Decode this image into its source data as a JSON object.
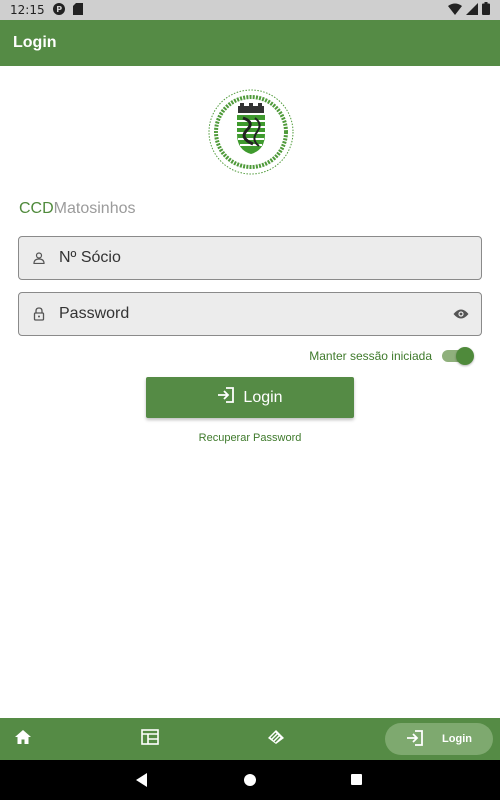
{
  "status_bar": {
    "time": "12:15"
  },
  "app_bar": {
    "title": "Login"
  },
  "brand": {
    "part1": "CCD",
    "part2": "Matosinhos"
  },
  "form": {
    "user": {
      "placeholder": "Nº Sócio",
      "value": ""
    },
    "password": {
      "placeholder": "Password",
      "value": ""
    },
    "remember_label": "Manter sessão iniciada",
    "remember_checked": true,
    "login_label": "Login",
    "recover_label": "Recuperar Password"
  },
  "bottom_nav": {
    "items": [
      {
        "icon": "home-icon"
      },
      {
        "icon": "calendar-icon"
      },
      {
        "icon": "cards-icon"
      },
      {
        "icon": "login-icon",
        "label": "Login",
        "active": true
      }
    ]
  },
  "colors": {
    "primary": "#558b45",
    "accent_text": "#3f7a2c",
    "brand_gray": "#9b9b9b"
  }
}
